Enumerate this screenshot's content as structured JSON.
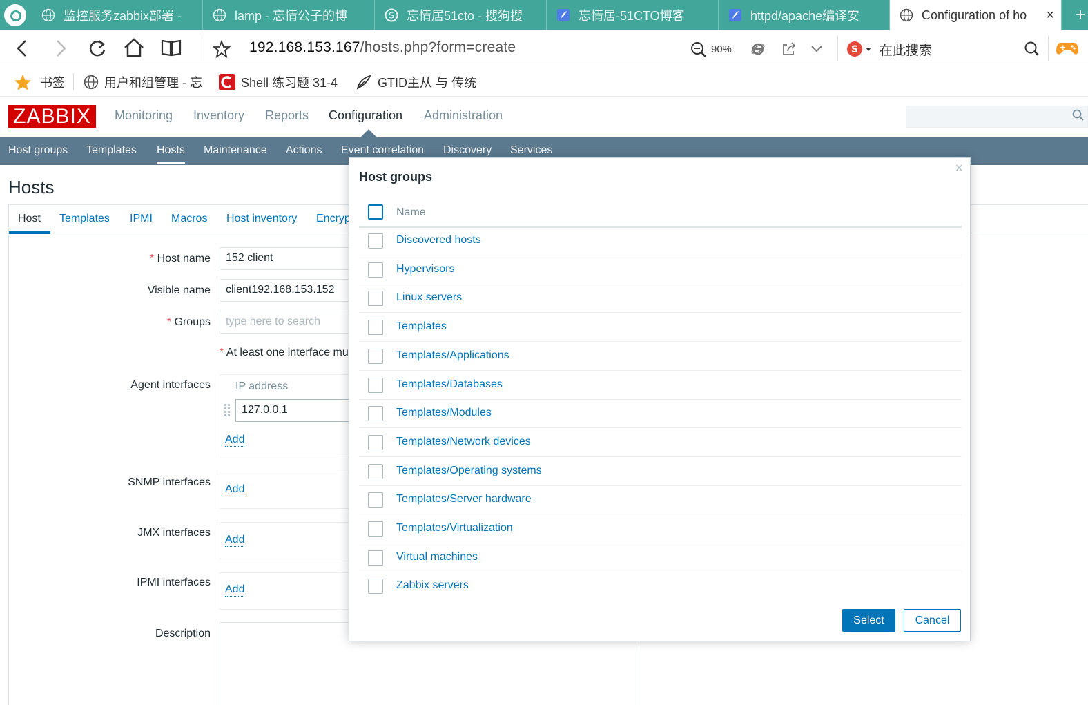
{
  "browser": {
    "tabs": [
      {
        "label": "监控服务zabbix部署 -",
        "icon": "globe-icon"
      },
      {
        "label": "lamp - 忘情公子的博",
        "icon": "globe-icon"
      },
      {
        "label": "忘情居51cto - 搜狗搜",
        "icon": "sogou-icon"
      },
      {
        "label": "忘情居-51CTO博客",
        "icon": "feather-icon"
      },
      {
        "label": "httpd/apache编译安",
        "icon": "feather-icon"
      },
      {
        "label": "Configuration of ho",
        "icon": "globe-icon"
      }
    ],
    "close_glyph": "×",
    "new_tab_glyph": "+",
    "url_host": "192.168.153.167",
    "url_path": "/hosts.php?form=create",
    "zoom": "90%",
    "search_engine_text": "在此搜索"
  },
  "bookmarks": [
    {
      "label": "书签",
      "icon": "star-icon"
    },
    {
      "label": "用户和组管理 - 忘",
      "icon": "globe-icon"
    },
    {
      "label": "Shell 练习题 31-4",
      "icon": "c-logo-icon"
    },
    {
      "label": "GTID主从 与 传统",
      "icon": "feather-icon"
    }
  ],
  "zabbix": {
    "logo": "ZABBIX",
    "top_menu": [
      "Monitoring",
      "Inventory",
      "Reports",
      "Configuration",
      "Administration"
    ],
    "top_menu_selected": "Configuration",
    "sub_menu": [
      "Host groups",
      "Templates",
      "Hosts",
      "Maintenance",
      "Actions",
      "Event correlation",
      "Discovery",
      "Services"
    ],
    "sub_menu_selected": "Hosts"
  },
  "page": {
    "title": "Hosts",
    "form_tabs": [
      "Host",
      "Templates",
      "IPMI",
      "Macros",
      "Host inventory",
      "Encryp"
    ],
    "form": {
      "host_name_label": "Host name",
      "host_name_value": "152 client",
      "visible_name_label": "Visible name",
      "visible_name_value": "client192.168.153.152",
      "groups_label": "Groups",
      "groups_placeholder": "type here to search",
      "interface_note": "At least one interface mu",
      "required_mark": "*",
      "agent_interfaces_label": "Agent interfaces",
      "ip_column_header": "IP address",
      "agent_ip_value": "127.0.0.1",
      "snmp_interfaces_label": "SNMP interfaces",
      "jmx_interfaces_label": "JMX interfaces",
      "ipmi_interfaces_label": "IPMI interfaces",
      "description_label": "Description",
      "add_link": "Add"
    }
  },
  "modal": {
    "title": "Host groups",
    "close_glyph": "×",
    "column_header": "Name",
    "groups": [
      "Discovered hosts",
      "Hypervisors",
      "Linux servers",
      "Templates",
      "Templates/Applications",
      "Templates/Databases",
      "Templates/Modules",
      "Templates/Network devices",
      "Templates/Operating systems",
      "Templates/Server hardware",
      "Templates/Virtualization",
      "Virtual machines",
      "Zabbix servers"
    ],
    "select_button": "Select",
    "cancel_button": "Cancel"
  }
}
